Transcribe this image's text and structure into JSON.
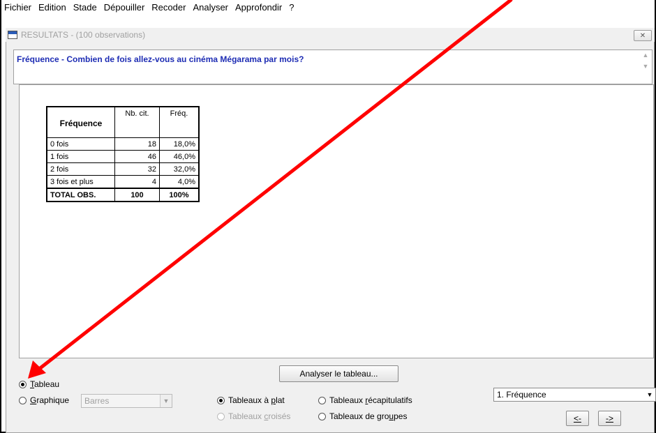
{
  "menu": [
    "Fichier",
    "Edition",
    "Stade",
    "Dépouiller",
    "Recoder",
    "Analyser",
    "Approfondir",
    "?"
  ],
  "window": {
    "title": "RESULTATS - (100 observations)",
    "close_label": "✕"
  },
  "question": "Fréquence - Combien de fois allez-vous au cinéma Mégarama par mois?",
  "table": {
    "header": {
      "label": "Fréquence",
      "count": "Nb. cit.",
      "freq": "Fréq."
    },
    "rows": [
      {
        "label": "0 fois",
        "count": "18",
        "freq": "18,0%"
      },
      {
        "label": "1 fois",
        "count": "46",
        "freq": "46,0%"
      },
      {
        "label": "2 fois",
        "count": "32",
        "freq": "32,0%"
      },
      {
        "label": "3 fois et plus",
        "count": "4",
        "freq": "4,0%"
      }
    ],
    "total": {
      "label": "TOTAL OBS.",
      "count": "100",
      "freq": "100%"
    }
  },
  "controls": {
    "analyse_button": "Analyser le tableau...",
    "tableau_prefix": "",
    "tableau_accel": "T",
    "tableau_rest": "ableau",
    "graphique_accel": "G",
    "graphique_rest": "raphique",
    "graph_type": "Barres",
    "plat_pre": "Tableaux à ",
    "plat_accel": "p",
    "plat_post": "lat",
    "recap_pre": "Tableaux ",
    "recap_accel": "r",
    "recap_post": "écapitulatifs",
    "croises_pre": "Tableaux ",
    "croises_accel": "c",
    "croises_post": "roisés",
    "groupes_pre": "Tableaux de gro",
    "groupes_accel": "u",
    "groupes_post": "pes",
    "analysis_select": "1. Fréquence",
    "prev_label": "<-",
    "next_label": "->"
  },
  "colors": {
    "question_text": "#1e2db4",
    "annotation_arrow": "#ff0000",
    "disabled_text": "#a0a0a0"
  }
}
